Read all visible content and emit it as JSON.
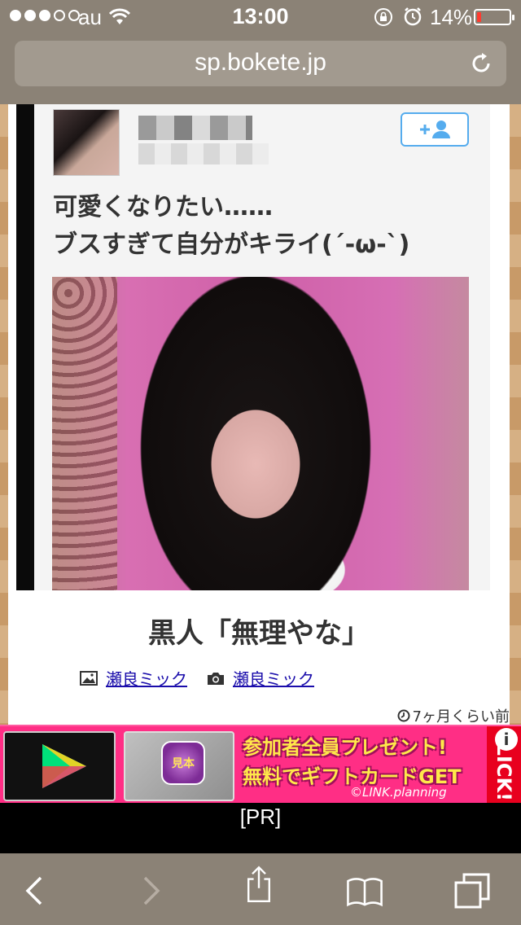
{
  "status_bar": {
    "carrier": "au",
    "time": "13:00",
    "battery_percent_label": "14%",
    "battery_level": 0.14,
    "signal_bars_filled": 3,
    "signal_bars_total": 5
  },
  "browser": {
    "url": "sp.bokete.jp"
  },
  "post": {
    "tweet_text_line1": "可愛くなりたい……",
    "tweet_text_line2": "ブスすぎて自分がキライ(´-ω-`)",
    "caption": "黒人「無理やな」",
    "image_author": "瀬良ミック",
    "photo_author": "瀬良ミック",
    "timestamp": "7ヶ月くらい前"
  },
  "ad": {
    "line1": "参加者全員プレゼント!",
    "line2": "無料でギフトカードGET",
    "copyright": "©LINK.planning",
    "click_label": "CLICK!",
    "info_label": "i",
    "app_badge": "見本",
    "pr_label": "[PR]"
  },
  "colors": {
    "chrome": "#8b8276",
    "link": "#1a0dab",
    "ad_bg": "#ff2e85",
    "battery_low": "#ff3b30"
  }
}
